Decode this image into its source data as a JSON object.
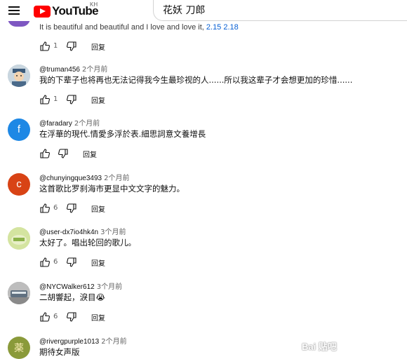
{
  "header": {
    "logo_text": "YouTube",
    "logo_country": "KH",
    "search_value": "花妖 刀郎"
  },
  "partial_comment": {
    "text": "It is beautiful and beautiful and I love and love it, ",
    "timestamps": "2.15 2.18",
    "like_count": "1",
    "reply_label": "回复"
  },
  "comments": [
    {
      "author": "@truman456",
      "time": "2个月前",
      "text": "我的下辈子也将再也无法记得我今生最珍视的人......所以我这辈子才会想更加的珍惜......",
      "like_count": "1",
      "reply_label": "回复",
      "avatar_letter": "",
      "avatar_color": "#a8b7c4"
    },
    {
      "author": "@faradary",
      "time": "2个月前",
      "text": "在浮華的現代.情愛多浮於表.細思詞意文養增長",
      "like_count": "",
      "reply_label": "回复",
      "avatar_letter": "f",
      "avatar_color": "#1e88e5"
    },
    {
      "author": "@chunyingque3493",
      "time": "2个月前",
      "text": "这首歌比罗刹海市更显中文文字的魅力。",
      "like_count": "6",
      "reply_label": "回复",
      "avatar_letter": "c",
      "avatar_color": "#d84315"
    },
    {
      "author": "@user-dx7io4hk4n",
      "time": "3个月前",
      "text": "太好了。唱出轮回的歌儿。",
      "like_count": "6",
      "reply_label": "回复",
      "avatar_letter": "",
      "avatar_color": "#c5d98a"
    },
    {
      "author": "@NYCWalker612",
      "time": "3个月前",
      "text": "二胡響起，淚目😭",
      "like_count": "6",
      "reply_label": "回复",
      "avatar_letter": "",
      "avatar_color": "#9e9e9e"
    },
    {
      "author": "@rivergpurple1013",
      "time": "2个月前",
      "text": "期待女声版",
      "like_count": "",
      "reply_label": "",
      "avatar_letter": "薬",
      "avatar_color": "#8a9a3a"
    }
  ],
  "watermark": "Bai 贴吧"
}
